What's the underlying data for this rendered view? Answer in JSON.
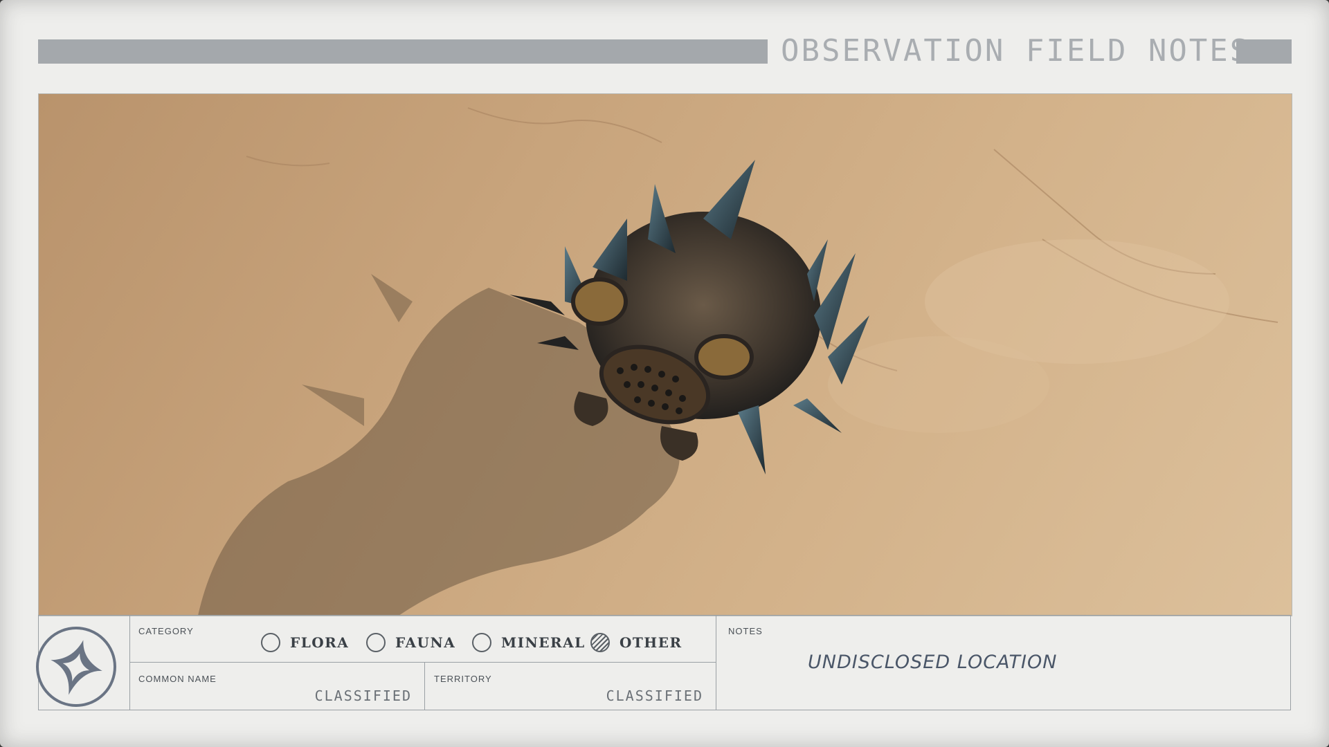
{
  "header": {
    "title": "OBSERVATION FIELD NOTES"
  },
  "photo": {
    "subject_icon": "creature-photo"
  },
  "table": {
    "logo_icon": "constellation-star-emblem-icon",
    "category": {
      "label": "CATEGORY",
      "options": [
        {
          "label": "FLORA",
          "selected": false
        },
        {
          "label": "FAUNA",
          "selected": false
        },
        {
          "label": "MINERAL",
          "selected": false
        },
        {
          "label": "OTHER",
          "selected": true
        }
      ]
    },
    "common_name": {
      "label": "COMMON NAME",
      "value": "CLASSIFIED"
    },
    "territory": {
      "label": "TERRITORY",
      "value": "CLASSIFIED"
    },
    "notes": {
      "label": "NOTES",
      "value": "UNDISCLOSED LOCATION"
    }
  },
  "colors": {
    "paper": "#eeeeec",
    "header_bar": "#a4a8ac",
    "ink": "#4a5668",
    "sand": "#c8a47c"
  }
}
